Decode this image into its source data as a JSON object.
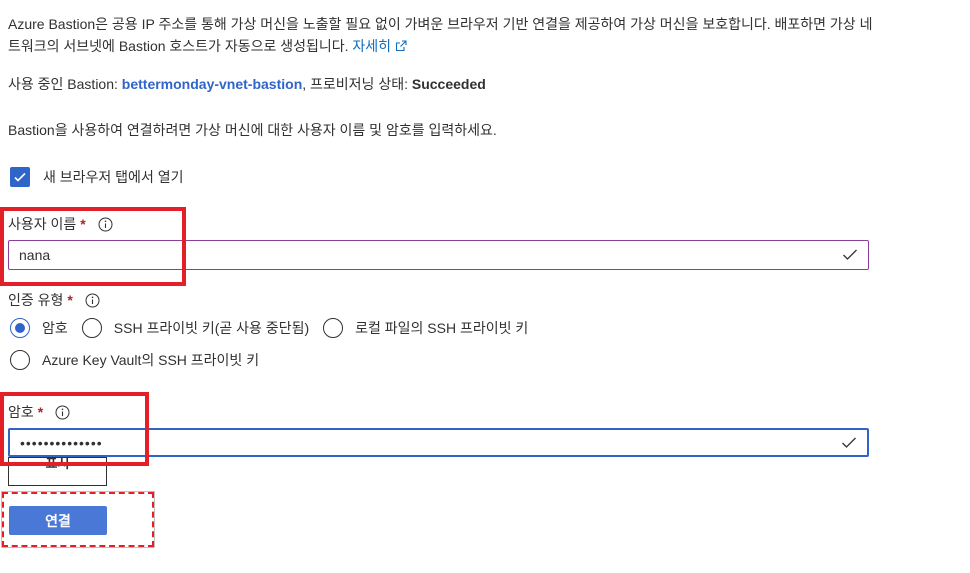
{
  "description": {
    "text": "Azure Bastion은 공용 IP 주소를 통해 가상 머신을 노출할 필요 없이 가벼운 브라우저 기반 연결을 제공하여 가상 머신을 보호합니다. 배포하면 가상 네트워크의 서브넷에 Bastion 호스트가 자동으로 생성됩니다.",
    "link_label": "자세히"
  },
  "status": {
    "prefix": "사용 중인 Bastion:",
    "bastion_name": "bettermonday-vnet-bastion",
    "state_prefix": ", 프로비저닝 상태:",
    "state_value": "Succeeded"
  },
  "instruction": "Bastion을 사용하여 연결하려면 가상 머신에 대한 사용자 이름 및 암호를 입력하세요.",
  "open_new_tab": {
    "label": "새 브라우저 탭에서 열기",
    "checked": true
  },
  "username": {
    "label": "사용자 이름",
    "required_mark": "*",
    "value": "nana"
  },
  "auth_type": {
    "label": "인증 유형",
    "required_mark": "*",
    "options": [
      "암호",
      "SSH 프라이빗 키(곧 사용 중단됨)",
      "로컬 파일의 SSH 프라이빗 키",
      "Azure Key Vault의 SSH 프라이빗 키"
    ],
    "selected": "암호"
  },
  "password": {
    "label": "암호",
    "required_mark": "*",
    "value": "••••••••••••••"
  },
  "show_button": "표시",
  "connect_button": "연결",
  "colors": {
    "accent": "#2f64c9",
    "connect_bg": "#4a78d6",
    "highlight": "#e32027",
    "required": "#a4262c"
  }
}
